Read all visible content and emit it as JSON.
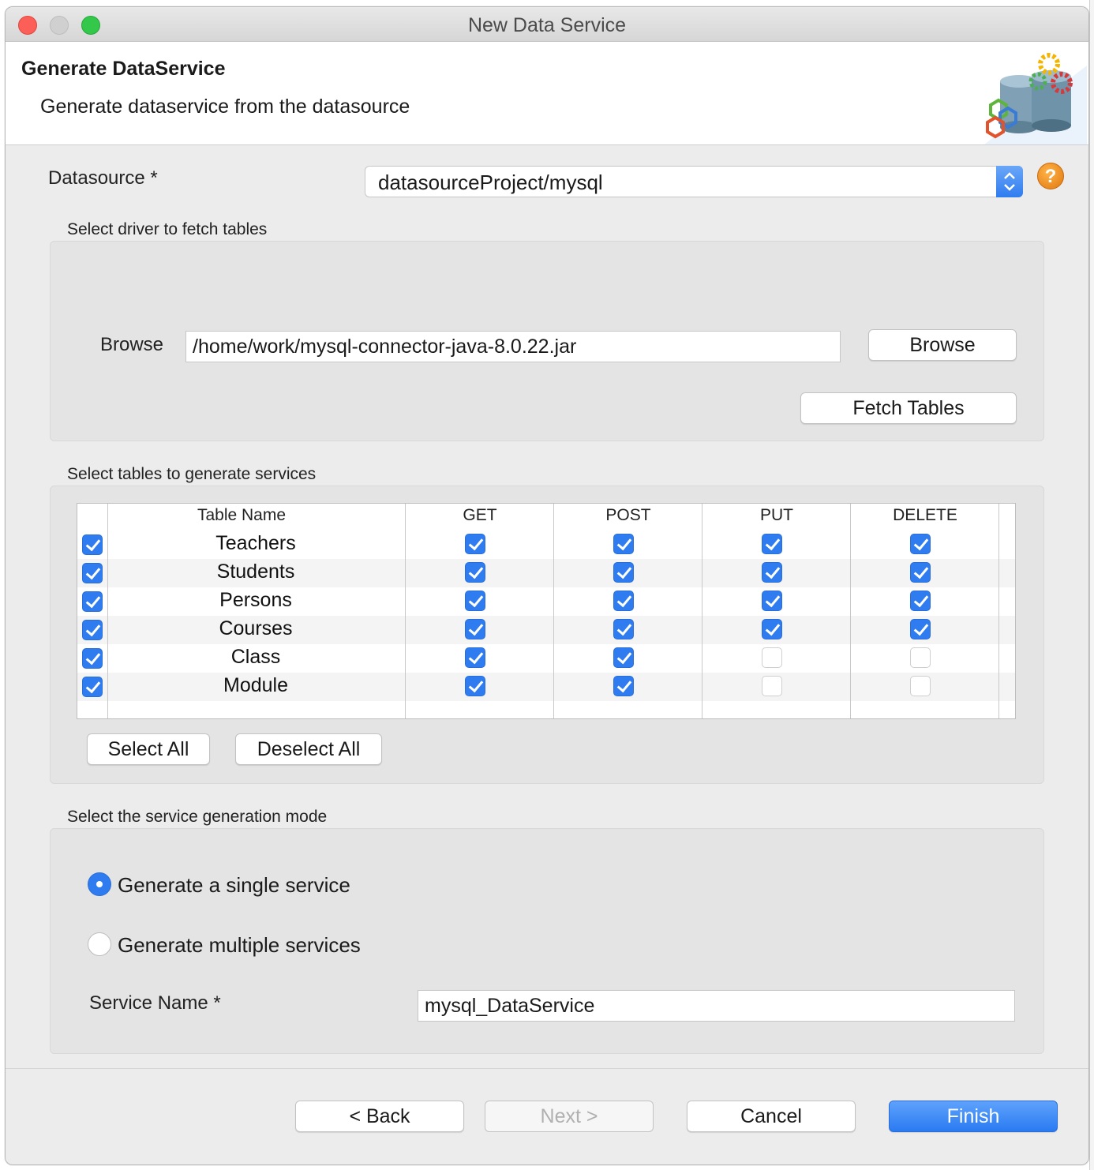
{
  "window": {
    "title": "New Data Service"
  },
  "header": {
    "title": "Generate DataService",
    "subtitle": "Generate dataservice from the datasource"
  },
  "datasource": {
    "label": "Datasource *",
    "value": "datasourceProject/mysql"
  },
  "driver_group": {
    "label": "Select driver to fetch tables",
    "browse_label": "Browse",
    "path_value": "/home/work/mysql-connector-java-8.0.22.jar",
    "browse_button": "Browse",
    "fetch_button": "Fetch Tables"
  },
  "tables_group": {
    "label": "Select tables to generate services",
    "columns": [
      "Table Name",
      "GET",
      "POST",
      "PUT",
      "DELETE"
    ],
    "rows": [
      {
        "selected": true,
        "name": "Teachers",
        "get": true,
        "post": true,
        "put": true,
        "delete": true
      },
      {
        "selected": true,
        "name": "Students",
        "get": true,
        "post": true,
        "put": true,
        "delete": true
      },
      {
        "selected": true,
        "name": "Persons",
        "get": true,
        "post": true,
        "put": true,
        "delete": true
      },
      {
        "selected": true,
        "name": "Courses",
        "get": true,
        "post": true,
        "put": true,
        "delete": true
      },
      {
        "selected": true,
        "name": "Class",
        "get": true,
        "post": true,
        "put": false,
        "delete": false
      },
      {
        "selected": true,
        "name": "Module",
        "get": true,
        "post": true,
        "put": false,
        "delete": false
      }
    ],
    "select_all": "Select All",
    "deselect_all": "Deselect All"
  },
  "mode_group": {
    "label": "Select the service generation mode",
    "options": [
      {
        "label": "Generate a single service",
        "selected": true
      },
      {
        "label": "Generate multiple services",
        "selected": false
      }
    ],
    "service_name_label": "Service Name *",
    "service_name_value": "mysql_DataService"
  },
  "footer": {
    "back": "< Back",
    "next": "Next >",
    "cancel": "Cancel",
    "finish": "Finish"
  },
  "colors": {
    "accent": "#2f7cf0",
    "help": "#e07810"
  }
}
